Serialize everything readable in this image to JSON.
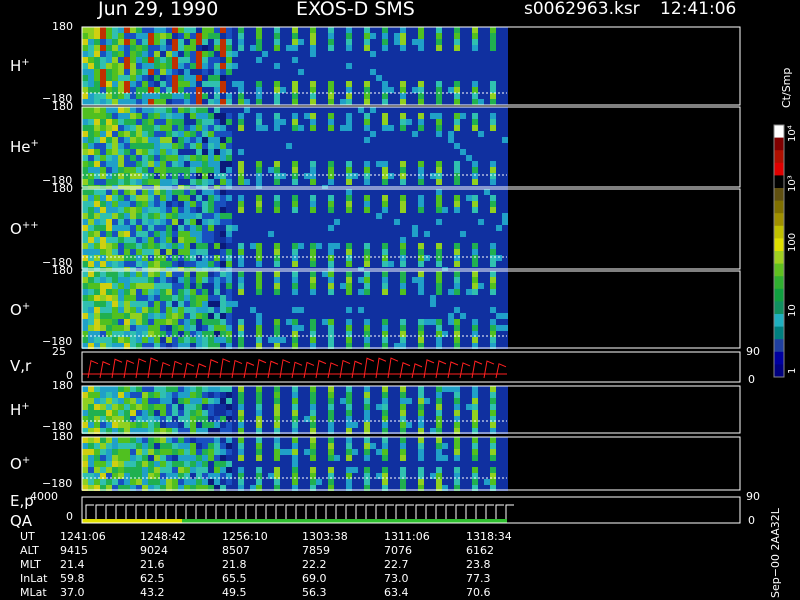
{
  "header": {
    "date": "Jun 29, 1990",
    "instrument": "EXOS-D SMS",
    "file": "s0062963.ksr",
    "time": "12:41:06"
  },
  "panels": [
    {
      "label": "H",
      "sup": "+",
      "ytop": "180",
      "ybot": "−180",
      "kind": "spectro",
      "era": "a"
    },
    {
      "label": "He",
      "sup": "+",
      "ytop": "180",
      "ybot": "−180",
      "kind": "spectro",
      "era": "b"
    },
    {
      "label": "O",
      "sup": "++",
      "ytop": "180",
      "ybot": "−180",
      "kind": "spectro",
      "era": "c"
    },
    {
      "label": "O",
      "sup": "+",
      "ytop": "180",
      "ybot": "−180",
      "kind": "spectro",
      "era": "d"
    },
    {
      "label": "V,r",
      "sup": "",
      "ytop": "25",
      "ybot": "0",
      "kind": "line",
      "right_top": "90",
      "right_bot": "0"
    },
    {
      "label": "H",
      "sup": "+",
      "ytop": "180",
      "ybot": "−180",
      "kind": "spectro",
      "era": "e"
    },
    {
      "label": "O",
      "sup": "+",
      "ytop": "180",
      "ybot": "−180",
      "kind": "spectro",
      "era": "f"
    },
    {
      "label": "E,p",
      "label2": "QA",
      "sup": "",
      "ytop": "4000",
      "ybot": "0",
      "kind": "step",
      "right_top": "90",
      "right_bot": "0"
    }
  ],
  "colorbar": {
    "unit": "Ct/Smp",
    "ticks": [
      "10⁴",
      "10³",
      "100",
      "10",
      "1"
    ],
    "colors": [
      "#ffffff",
      "#800000",
      "#b01000",
      "#e00000",
      "#000000",
      "#605010",
      "#807000",
      "#a09000",
      "#c0c000",
      "#e0e000",
      "#a0d020",
      "#60c020",
      "#30b030",
      "#10a040",
      "#109060",
      "#20b0c0",
      "#008080",
      "#2040a0",
      "#0000a0",
      "#000080"
    ]
  },
  "footer_note": "Sep−00 2AA32L",
  "ephemeris": {
    "rows": [
      {
        "label": "UT",
        "values": [
          "1241:06",
          "1248:42",
          "1256:10",
          "1303:38",
          "1311:06",
          "1318:34"
        ]
      },
      {
        "label": "ALT",
        "values": [
          "9415",
          "9024",
          "8507",
          "7859",
          "7076",
          "6162"
        ]
      },
      {
        "label": "MLT",
        "values": [
          "21.4",
          "21.6",
          "21.8",
          "22.2",
          "22.7",
          "23.8"
        ]
      },
      {
        "label": "InLat",
        "values": [
          "59.8",
          "62.5",
          "65.5",
          "69.0",
          "73.0",
          "77.3"
        ]
      },
      {
        "label": "MLat",
        "values": [
          "37.0",
          "43.2",
          "49.5",
          "56.3",
          "63.4",
          "70.6"
        ]
      }
    ]
  },
  "chart_data": {
    "type": "heatmap",
    "title": "Jun 29, 1990   EXOS-D SMS",
    "x_ticks": [
      "1241:06",
      "1248:42",
      "1256:10",
      "1303:38",
      "1311:06",
      "1318:34"
    ],
    "y_range_pitch_deg": [
      -180,
      180
    ],
    "series": [
      {
        "name": "H+"
      },
      {
        "name": "He+"
      },
      {
        "name": "O++"
      },
      {
        "name": "O+"
      },
      {
        "name": "V,r",
        "ylim": [
          0,
          25
        ],
        "right_ylim": [
          0,
          90
        ]
      },
      {
        "name": "H+"
      },
      {
        "name": "O+"
      },
      {
        "name": "E,p",
        "ylim": [
          0,
          4000
        ],
        "right_ylim": [
          0,
          90
        ]
      }
    ],
    "colorbar_unit": "Ct/Smp",
    "colorbar_range": [
      1,
      10000
    ],
    "colorbar_scale": "log"
  }
}
